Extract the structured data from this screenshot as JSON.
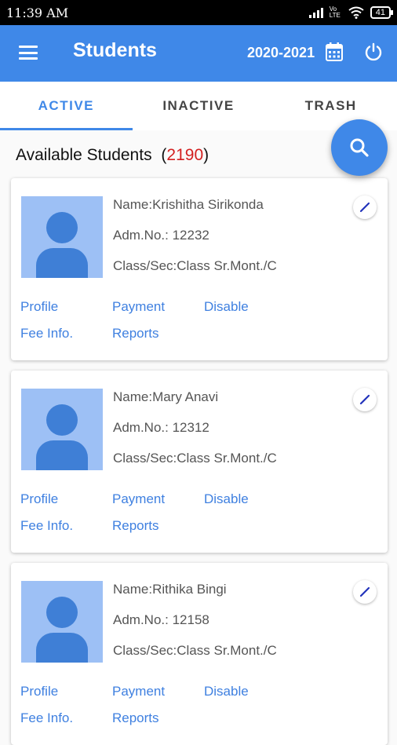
{
  "status_bar": {
    "time": "11:39 AM",
    "network": "Vo LTE",
    "battery": "41"
  },
  "app_bar": {
    "title": "Students",
    "year": "2020-2021"
  },
  "tabs": [
    {
      "label": "ACTIVE",
      "active": true
    },
    {
      "label": "INACTIVE",
      "active": false
    },
    {
      "label": "TRASH",
      "active": false
    }
  ],
  "summary": {
    "label": "Available Students",
    "open": "(",
    "count": "2190",
    "close": ")"
  },
  "students": [
    {
      "name": "Name:Krishitha Sirikonda",
      "adm": "Adm.No.: 12232",
      "class": "Class/Sec:Class Sr.Mont./C",
      "links": {
        "profile": "Profile",
        "payment": "Payment",
        "disable": "Disable",
        "fee": "Fee Info.",
        "reports": "Reports"
      }
    },
    {
      "name": "Name:Mary Anavi",
      "adm": "Adm.No.: 12312",
      "class": "Class/Sec:Class Sr.Mont./C",
      "links": {
        "profile": "Profile",
        "payment": "Payment",
        "disable": "Disable",
        "fee": "Fee Info.",
        "reports": "Reports"
      }
    },
    {
      "name": "Name:Rithika Bingi",
      "adm": "Adm.No.: 12158",
      "class": "Class/Sec:Class Sr.Mont./C",
      "links": {
        "profile": "Profile",
        "payment": "Payment",
        "disable": "Disable",
        "fee": "Fee Info.",
        "reports": "Reports"
      }
    }
  ],
  "colors": {
    "primary": "#3f88e8",
    "count": "#d32020",
    "avatar_bg": "#9dc0f5"
  },
  "icons": [
    "menu-icon",
    "calendar-icon",
    "power-icon",
    "search-icon",
    "edit-pencil-icon",
    "avatar-placeholder-icon"
  ]
}
